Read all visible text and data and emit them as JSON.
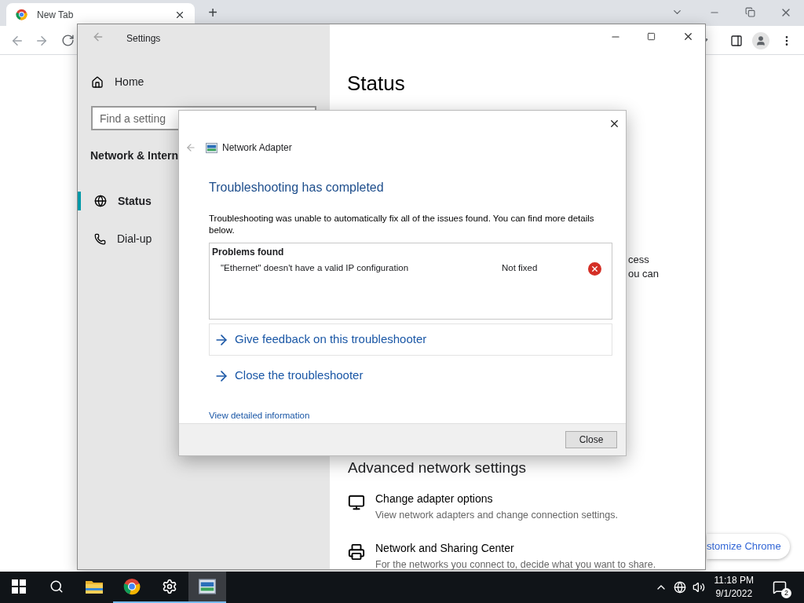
{
  "browser": {
    "tab_title": "New Tab",
    "new_tab_button": "+",
    "customize_button": "stomize Chrome"
  },
  "settings": {
    "title": "Settings",
    "home": "Home",
    "search": {
      "placeholder": "Find a setting"
    },
    "section": "Network & Intern",
    "nav": [
      {
        "kind": "globe",
        "label": "Status",
        "selected": true
      },
      {
        "kind": "phone",
        "label": "Dial-up",
        "selected": false
      }
    ],
    "page_title": "Status",
    "fragments": [
      "cess",
      "ou can"
    ],
    "advanced_heading": "Advanced network settings",
    "links": [
      {
        "kind": "adapter",
        "title": "Change adapter options",
        "description": "View network adapters and change connection settings."
      },
      {
        "kind": "sharing",
        "title": "Network and Sharing Center",
        "description": "For the networks you connect to, decide what you want to share."
      }
    ]
  },
  "dialog": {
    "title": "Network Adapter",
    "heading": "Troubleshooting has completed",
    "message": "Troubleshooting was unable to automatically fix all of the issues found. You can find more details below.",
    "problems_header": "Problems found",
    "problems": [
      {
        "description": "\"Ethernet\" doesn't have a valid IP configuration",
        "status": "Not fixed",
        "fixed": false
      }
    ],
    "actions": [
      {
        "label": "Give feedback on this troubleshooter",
        "boxed": true
      },
      {
        "label": "Close the troubleshooter",
        "boxed": false
      }
    ],
    "detail_link": "View detailed information",
    "close_button": "Close"
  },
  "taskbar": {
    "apps": [
      {
        "kind": "start",
        "running": false,
        "selected": false
      },
      {
        "kind": "search",
        "running": false,
        "selected": false
      },
      {
        "kind": "explorer",
        "running": false,
        "selected": false
      },
      {
        "kind": "chrome",
        "running": true,
        "selected": false
      },
      {
        "kind": "settings",
        "running": true,
        "selected": false
      },
      {
        "kind": "adapter",
        "running": true,
        "selected": true
      }
    ],
    "time": "11:18 PM",
    "date": "9/1/2022",
    "notifications": "2"
  }
}
